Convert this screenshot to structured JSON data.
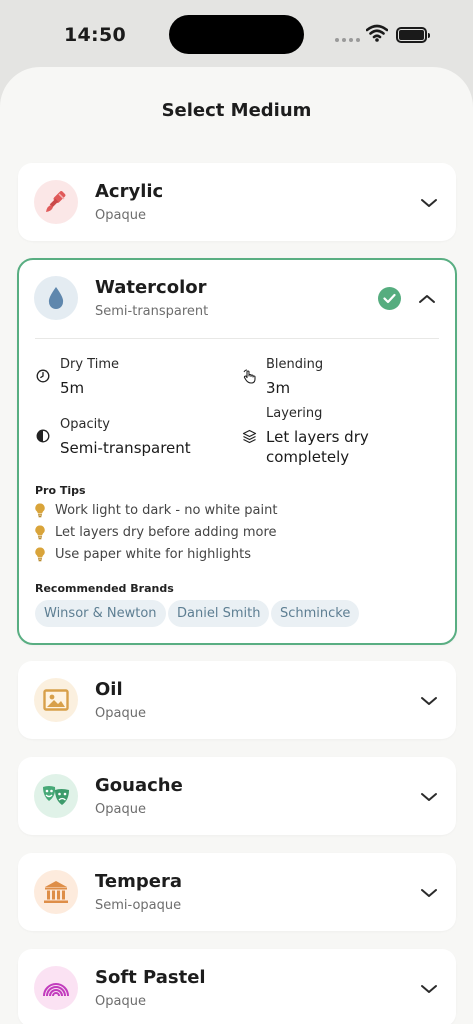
{
  "status": {
    "time": "14:50"
  },
  "sheet": {
    "title": "Select Medium"
  },
  "colors": {
    "accent": "#59ae82",
    "check": "#56ad7f",
    "chip_bg": "#eaf0f4",
    "chip_text": "#5d7e92"
  },
  "media": [
    {
      "name": "Acrylic",
      "subtitle": "Opaque",
      "icon": "paintbrush-icon",
      "expanded": false,
      "selected": false
    },
    {
      "name": "Watercolor",
      "subtitle": "Semi-transparent",
      "icon": "water-drop-icon",
      "expanded": true,
      "selected": true
    },
    {
      "name": "Oil",
      "subtitle": "Opaque",
      "icon": "picture-frame-icon",
      "expanded": false,
      "selected": false
    },
    {
      "name": "Gouache",
      "subtitle": "Opaque",
      "icon": "theater-masks-icon",
      "expanded": false,
      "selected": false
    },
    {
      "name": "Tempera",
      "subtitle": "Semi-opaque",
      "icon": "classical-building-icon",
      "expanded": false,
      "selected": false
    },
    {
      "name": "Soft Pastel",
      "subtitle": "Opaque",
      "icon": "rainbow-icon",
      "expanded": false,
      "selected": false
    }
  ],
  "details": {
    "dry_time_label": "Dry Time",
    "dry_time_value": "5m",
    "blending_label": "Blending",
    "blending_value": "3m",
    "opacity_label": "Opacity",
    "opacity_value": "Semi-transparent",
    "layering_label": "Layering",
    "layering_value": "Let layers dry completely",
    "tips_title": "Pro Tips",
    "tips": [
      "Work light to dark - no white paint",
      "Let layers dry before adding more",
      "Use paper white for highlights"
    ],
    "brands_title": "Recommended Brands",
    "brands": [
      "Winsor & Newton",
      "Daniel Smith",
      "Schmincke"
    ]
  }
}
